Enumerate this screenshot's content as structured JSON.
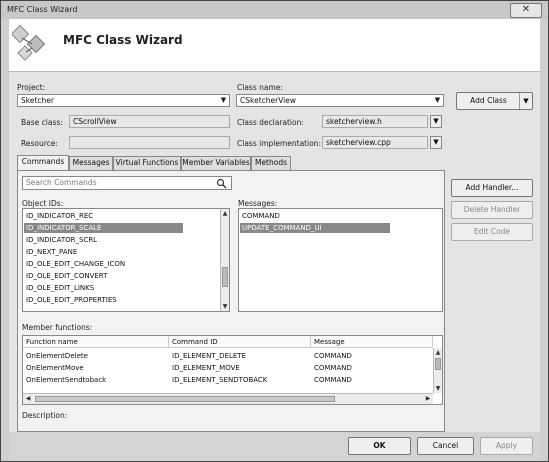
{
  "window": {
    "title": "MFC Class Wizard",
    "close_glyph": "✕"
  },
  "header": {
    "title": "MFC Class Wizard"
  },
  "form": {
    "project_label": "Project:",
    "project_value": "Sketcher",
    "class_name_label": "Class name:",
    "class_name_value": "CSketcherView",
    "add_class_label": "Add Class",
    "base_class_label": "Base class:",
    "base_class_value": "CScrollView",
    "class_declaration_label": "Class declaration:",
    "class_declaration_value": "sketcherview.h",
    "resource_label": "Resource:",
    "resource_value": "",
    "class_implementation_label": "Class implementation:",
    "class_implementation_value": "sketcherview.cpp"
  },
  "tabs": [
    "Commands",
    "Messages",
    "Virtual Functions",
    "Member Variables",
    "Methods"
  ],
  "commands": {
    "search_placeholder": "Search Commands",
    "object_ids_label": "Object IDs:",
    "object_ids": [
      "ID_INDICATOR_REC",
      "ID_INDICATOR_SCALE",
      "ID_INDICATOR_SCRL",
      "ID_NEXT_PANE",
      "ID_OLE_EDIT_CHANGE_ICON",
      "ID_OLE_EDIT_CONVERT",
      "ID_OLE_EDIT_LINKS",
      "ID_OLE_EDIT_PROPERTIES"
    ],
    "messages_label": "Messages:",
    "messages": [
      "COMMAND",
      "UPDATE_COMMAND_UI"
    ],
    "member_functions_label": "Member functions:",
    "columns": [
      "Function name",
      "Command ID",
      "Message"
    ],
    "rows": [
      [
        "OnElementDelete",
        "ID_ELEMENT_DELETE",
        "COMMAND"
      ],
      [
        "OnElementMove",
        "ID_ELEMENT_MOVE",
        "COMMAND"
      ],
      [
        "OnElementSendtoback",
        "ID_ELEMENT_SENDTOBACK",
        "COMMAND"
      ]
    ],
    "description_label": "Description:"
  },
  "side_buttons": {
    "add_handler": "Add Handler...",
    "delete_handler": "Delete Handler",
    "edit_code": "Edit Code"
  },
  "footer": {
    "ok": "OK",
    "cancel": "Cancel",
    "apply": "Apply"
  },
  "colors": {
    "selection": "#888888",
    "window_bg": "#cfcfcf"
  }
}
